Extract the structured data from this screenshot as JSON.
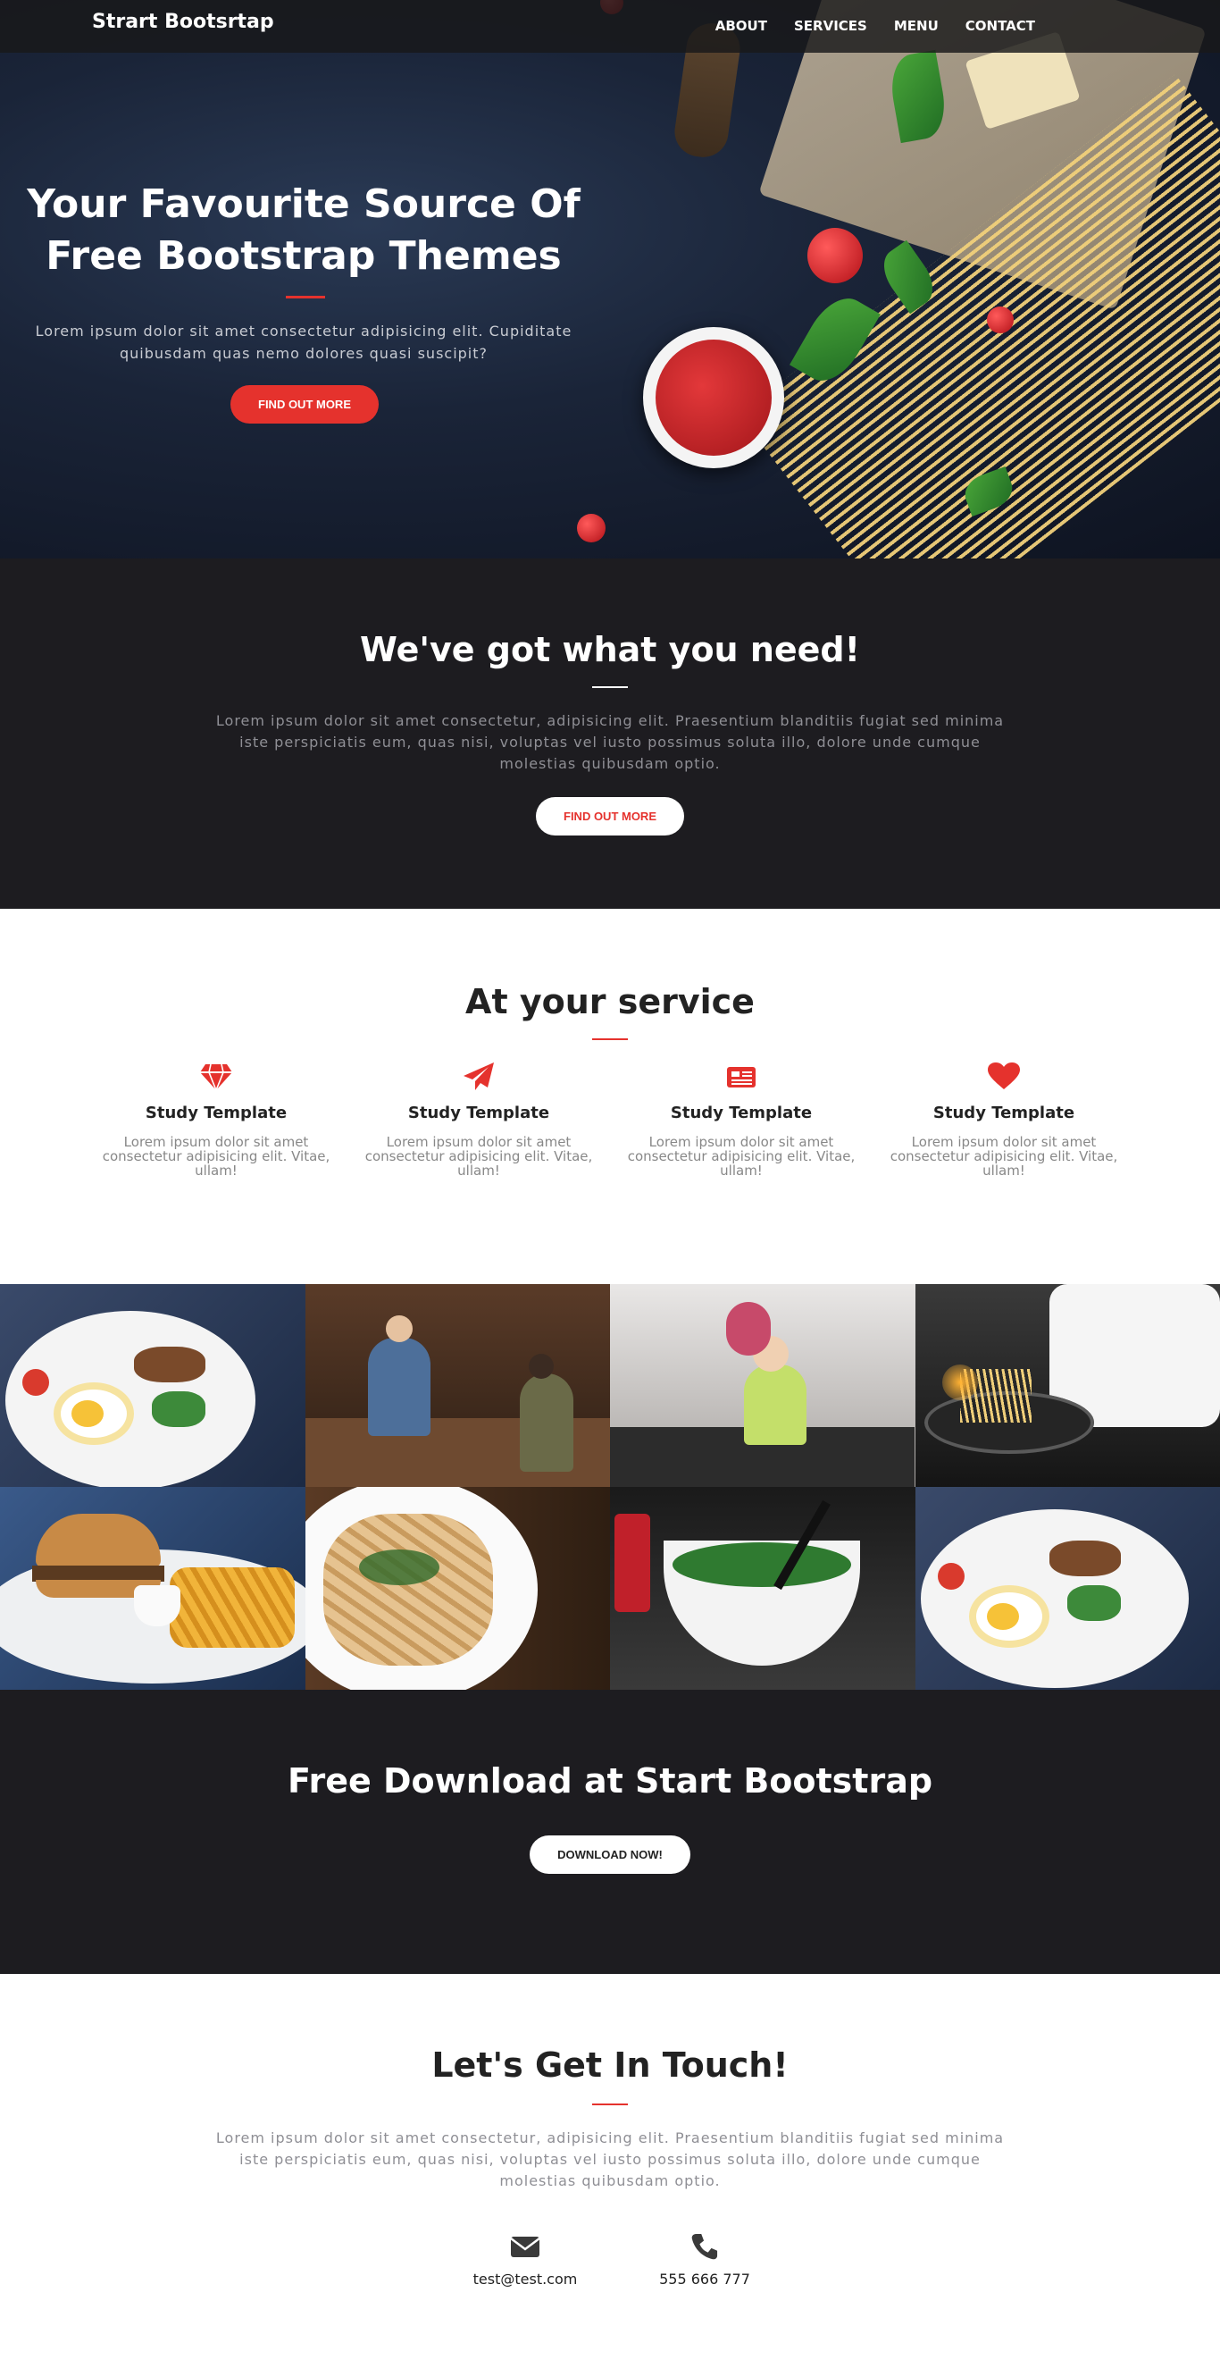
{
  "nav": {
    "brand": "Strart Bootsrtap",
    "links": [
      "ABOUT",
      "SERVICES",
      "MENU",
      "CONTACT"
    ]
  },
  "hero": {
    "title": "Your Favourite Source Of Free Bootstrap Themes",
    "subtitle": "Lorem ipsum dolor sit amet consectetur adipisicing elit. Cupiditate quibusdam quas nemo dolores quasi suscipit?",
    "button": "FIND OUT MORE"
  },
  "need": {
    "title": "We've got what you need!",
    "text": "Lorem ipsum dolor sit amet consectetur, adipisicing elit. Praesentium blanditiis fugiat sed minima iste perspiciatis eum, quas nisi, voluptas vel iusto possimus soluta illo, dolore unde cumque molestias quibusdam optio.",
    "button": "FIND OUT MORE"
  },
  "services": {
    "title": "At your service",
    "items": [
      {
        "icon": "diamond-icon",
        "title": "Study Template",
        "text": "Lorem ipsum dolor sit amet consectetur adipisicing elit. Vitae, ullam!"
      },
      {
        "icon": "paper-plane-icon",
        "title": "Study Template",
        "text": "Lorem ipsum dolor sit amet consectetur adipisicing elit. Vitae, ullam!"
      },
      {
        "icon": "newspaper-icon",
        "title": "Study Template",
        "text": "Lorem ipsum dolor sit amet consectetur adipisicing elit. Vitae, ullam!"
      },
      {
        "icon": "heart-icon",
        "title": "Study Template",
        "text": "Lorem ipsum dolor sit amet consectetur adipisicing elit. Vitae, ullam!"
      }
    ]
  },
  "gallery": {
    "tiles": [
      "breakfast-plate",
      "bar-scene",
      "kitchen-girl",
      "chef-cooking",
      "burger-fries",
      "pasta-plate",
      "salad-bowl",
      "breakfast-plate-2"
    ]
  },
  "download": {
    "title": "Free Download at Start Bootstrap",
    "button": "DOWNLOAD NOW!"
  },
  "contact": {
    "title": "Let's Get In Touch!",
    "text": "Lorem ipsum dolor sit amet consectetur, adipisicing elit. Praesentium blanditiis fugiat sed minima iste perspiciatis eum, quas nisi, voluptas vel iusto possimus soluta illo, dolore unde cumque molestias quibusdam optio.",
    "email": "test@test.com",
    "phone": "555 666 777",
    "email_icon": "envelope-icon",
    "phone_icon": "phone-icon"
  },
  "colors": {
    "accent": "#e5322d",
    "dark": "#1d1c20"
  }
}
